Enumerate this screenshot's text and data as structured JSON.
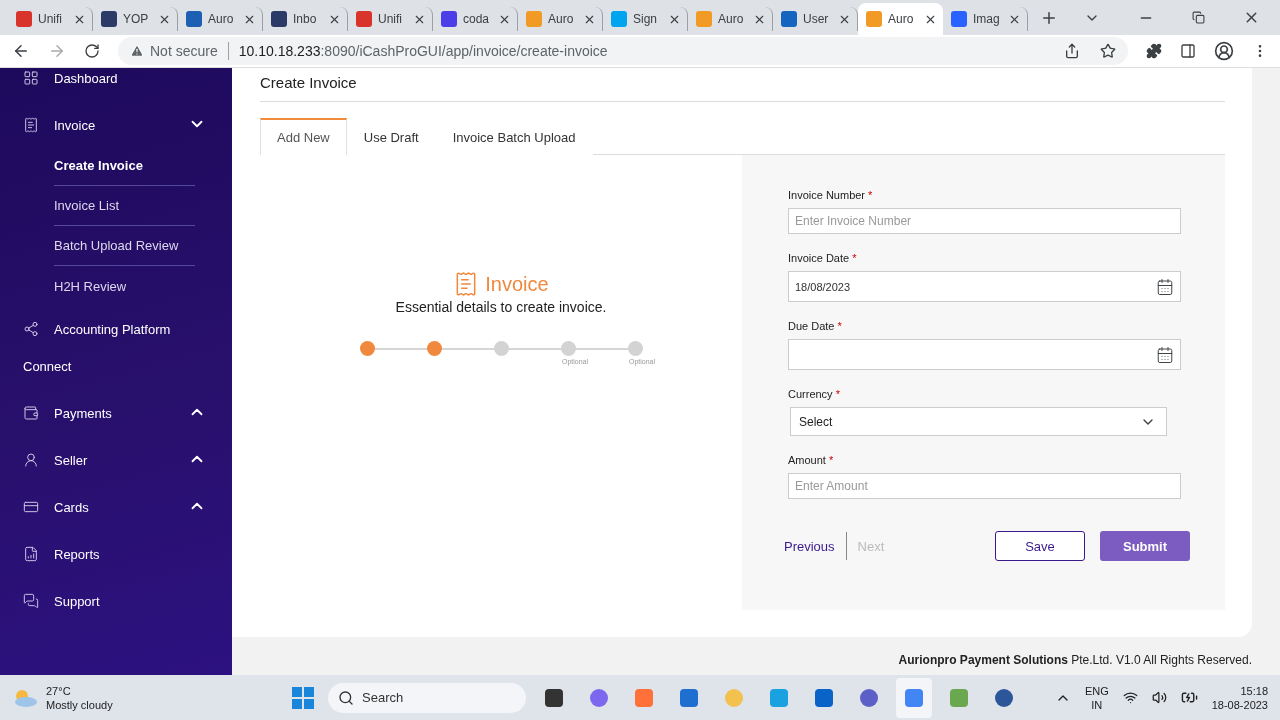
{
  "browser": {
    "tabs": [
      {
        "title": "Unifi",
        "selected": false
      },
      {
        "title": "YOP",
        "selected": false
      },
      {
        "title": "Auro",
        "selected": false
      },
      {
        "title": "Inbo",
        "selected": false
      },
      {
        "title": "Unifi",
        "selected": false
      },
      {
        "title": "coda",
        "selected": false
      },
      {
        "title": "Auro",
        "selected": false
      },
      {
        "title": "Sign",
        "selected": false
      },
      {
        "title": "Auro",
        "selected": false
      },
      {
        "title": "User",
        "selected": false
      },
      {
        "title": "Auro",
        "selected": true
      },
      {
        "title": "Imag",
        "selected": false
      }
    ],
    "security": "Not secure",
    "url_host": "10.10.18.233",
    "url_path": ":8090/iCashProGUI/app/invoice/create-invoice"
  },
  "sidebar": {
    "items": [
      {
        "label": "Dashboard"
      },
      {
        "label": "Invoice",
        "expanded": true,
        "children": [
          {
            "label": "Create Invoice",
            "selected": true
          },
          {
            "label": "Invoice List",
            "selected": false
          },
          {
            "label": "Batch Upload Review",
            "selected": false
          },
          {
            "label": "H2H Review",
            "selected": false
          }
        ]
      },
      {
        "label": "Accounting Platform Connect"
      },
      {
        "label": "Payments",
        "expanded": false
      },
      {
        "label": "Seller",
        "expanded": false
      },
      {
        "label": "Cards",
        "expanded": false
      },
      {
        "label": "Reports"
      },
      {
        "label": "Support"
      }
    ]
  },
  "page": {
    "title": "Create Invoice",
    "tabs": [
      {
        "label": "Add New",
        "selected": true
      },
      {
        "label": "Use Draft",
        "selected": false
      },
      {
        "label": "Invoice Batch Upload",
        "selected": false
      }
    ],
    "intro": {
      "title": "Invoice",
      "subtitle": "Essential details to create invoice.",
      "steps": [
        {
          "completed": true
        },
        {
          "completed": true
        },
        {
          "completed": false
        },
        {
          "completed": false,
          "note": "Optional"
        },
        {
          "completed": false,
          "note": "Optional"
        }
      ]
    },
    "form": {
      "fields": [
        {
          "kind": "text",
          "label": "Invoice Number",
          "required": "*",
          "placeholder": "Enter Invoice Number"
        },
        {
          "kind": "date",
          "label": "Invoice Date",
          "required": "*",
          "value": "18/08/2023"
        },
        {
          "kind": "date",
          "label": "Due Date",
          "required": "*"
        },
        {
          "kind": "select",
          "label": "Currency",
          "required": "*",
          "value": "Select"
        },
        {
          "kind": "text",
          "label": "Amount",
          "required": "*",
          "placeholder": "Enter Amount"
        }
      ],
      "previous": {
        "label": "Previous",
        "disabled": false
      },
      "next": {
        "label": "Next",
        "disabled": true
      },
      "save": "Save",
      "submit": "Submit"
    }
  },
  "footer": "**Aurionpro Payment Solutions** Pte.Ltd. V1.0 All Rights Reserved.",
  "taskbar": {
    "temperature": "27°C",
    "weather": "Mostly cloudy",
    "search_placeholder": "Search",
    "apps": [
      {
        "selected": false
      },
      {
        "selected": false
      },
      {
        "selected": false
      },
      {
        "selected": false
      },
      {
        "selected": false
      },
      {
        "selected": false
      },
      {
        "selected": false
      },
      {
        "selected": false
      },
      {
        "selected": true
      },
      {
        "selected": false
      },
      {
        "selected": false
      }
    ],
    "language": "ENG",
    "region": "IN",
    "time": "15:18",
    "date": "18-08-2023"
  }
}
